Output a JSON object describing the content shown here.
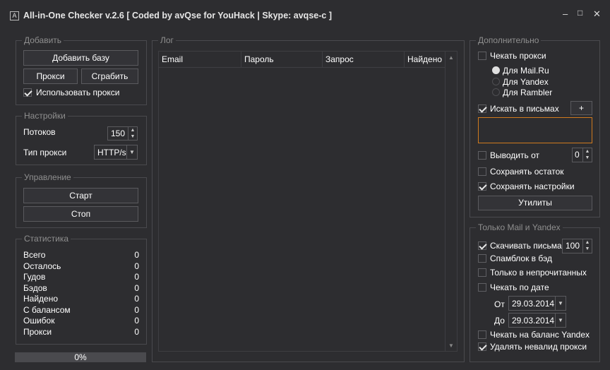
{
  "window": {
    "title": "All-in-One Checker v.2.6  [ Coded by avQse for YouHack | Skype: avqse-c ]",
    "icon": "app-icon"
  },
  "add_group": {
    "title": "Добавить",
    "add_base": "Добавить базу",
    "proxy": "Прокси",
    "grab": "Сграбить",
    "use_proxy": {
      "label": "Использовать прокси",
      "checked": true
    }
  },
  "settings_group": {
    "title": "Настройки",
    "threads_label": "Потоков",
    "threads_value": "150",
    "proxy_type_label": "Тип прокси",
    "proxy_type_value": "HTTP/s"
  },
  "control_group": {
    "title": "Управление",
    "start": "Старт",
    "stop": "Стоп"
  },
  "stats_group": {
    "title": "Статистика",
    "rows": [
      {
        "label": "Всего",
        "value": "0"
      },
      {
        "label": "Осталось",
        "value": "0"
      },
      {
        "label": "Гудов",
        "value": "0"
      },
      {
        "label": "Бэдов",
        "value": "0"
      },
      {
        "label": "Найдено",
        "value": "0"
      },
      {
        "label": "С балансом",
        "value": "0"
      },
      {
        "label": "Ошибок",
        "value": "0"
      },
      {
        "label": "Прокси",
        "value": "0"
      }
    ]
  },
  "progress": {
    "text": "0%",
    "percent": 0
  },
  "log_group": {
    "title": "Лог",
    "columns": [
      "Email",
      "Пароль",
      "Запрос",
      "Найдено"
    ]
  },
  "extra_group": {
    "title": "Дополнительно",
    "check_proxy": {
      "label": "Чекать прокси",
      "checked": false
    },
    "radios": [
      {
        "label": "Для Mail.Ru",
        "selected": true
      },
      {
        "label": "Для Yandex",
        "selected": false
      },
      {
        "label": "Для Rambler",
        "selected": false
      }
    ],
    "search_in_mails": {
      "label": "Искать в письмах",
      "checked": true
    },
    "plus": "+",
    "output_from": {
      "label": "Выводить от",
      "checked": false,
      "value": "0"
    },
    "save_rest": {
      "label": "Сохранять остаток",
      "checked": false
    },
    "save_settings": {
      "label": "Сохранять настройки",
      "checked": true
    },
    "utilities": "Утилиты"
  },
  "mail_yandex_group": {
    "title": "Только Mail и Yandex",
    "download_mails": {
      "label": "Скачивать письма",
      "checked": true,
      "value": "100"
    },
    "spamblock": {
      "label": "Спамблок в бэд",
      "checked": false
    },
    "unread_only": {
      "label": "Только в непрочитанных",
      "checked": false
    },
    "check_by_date": {
      "label": "Чекать по дате",
      "checked": false
    },
    "from_label": "От",
    "from_date": "29.03.2014",
    "to_label": "До",
    "to_date": "29.03.2014",
    "check_balance": {
      "label": "Чекать на баланс Yandex",
      "checked": false
    },
    "delete_invalid_proxy": {
      "label": "Удалять невалид прокси",
      "checked": true
    }
  },
  "colors": {
    "background": "#2d2d30",
    "border": "#4a4a4e",
    "accent_textbox": "#d07a1e"
  }
}
